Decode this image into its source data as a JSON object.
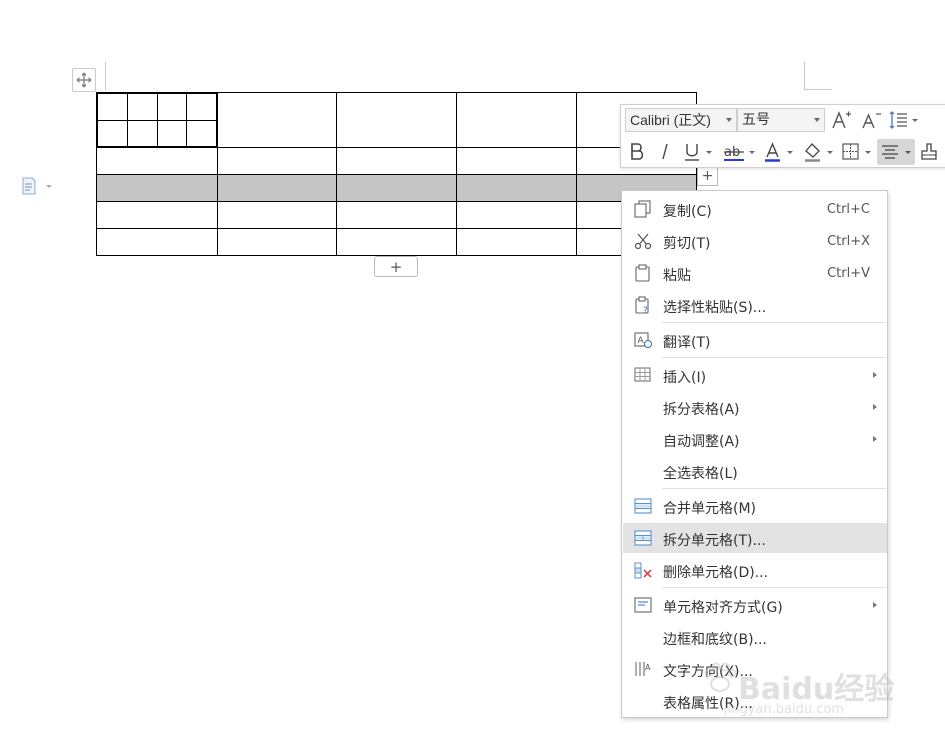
{
  "toolbar": {
    "font_name": "Calibri (正文)",
    "font_size": "五号",
    "tools": [
      "grow-font",
      "shrink-font",
      "line-spacing",
      "bold",
      "italic",
      "underline",
      "strikethrough-format",
      "font-color",
      "highlight",
      "borders",
      "align-center",
      "format-painter"
    ]
  },
  "table": {
    "add_row_label": "+",
    "add_col_label": "+"
  },
  "context_menu": {
    "items": [
      {
        "label": "复制(C)",
        "shortcut": "Ctrl+C",
        "icon": "copy-icon"
      },
      {
        "label": "剪切(T)",
        "shortcut": "Ctrl+X",
        "icon": "scissors-icon"
      },
      {
        "label": "粘贴",
        "shortcut": "Ctrl+V",
        "icon": "clipboard-icon"
      },
      {
        "label": "选择性粘贴(S)...",
        "icon": "paste-special-icon"
      },
      {
        "label": "翻译(T)",
        "icon": "translate-icon"
      },
      {
        "label": "插入(I)",
        "icon": "table-insert-icon",
        "submenu": true
      },
      {
        "label": "拆分表格(A)",
        "submenu": true
      },
      {
        "label": "自动调整(A)",
        "submenu": true
      },
      {
        "label": "全选表格(L)"
      },
      {
        "label": "合并单元格(M)",
        "icon": "merge-cells-icon"
      },
      {
        "label": "拆分单元格(T)...",
        "icon": "split-cells-icon",
        "highlighted": true
      },
      {
        "label": "删除单元格(D)...",
        "icon": "delete-cells-icon"
      },
      {
        "label": "单元格对齐方式(G)",
        "icon": "cell-align-icon",
        "submenu": true
      },
      {
        "label": "边框和底纹(B)..."
      },
      {
        "label": "文字方向(X)...",
        "icon": "text-direction-icon"
      },
      {
        "label": "表格属性(R)..."
      }
    ]
  },
  "watermark": {
    "text": "Baidu经验",
    "url_text": "jingyan.baidu.com"
  },
  "colors": {
    "shaded_row": "#c6c6c6",
    "menu_highlight": "#e3e3e3",
    "font_color_bar": "#2b3ad6",
    "strike_bar": "#2b3ad6",
    "highlight_bar": "#888888"
  }
}
